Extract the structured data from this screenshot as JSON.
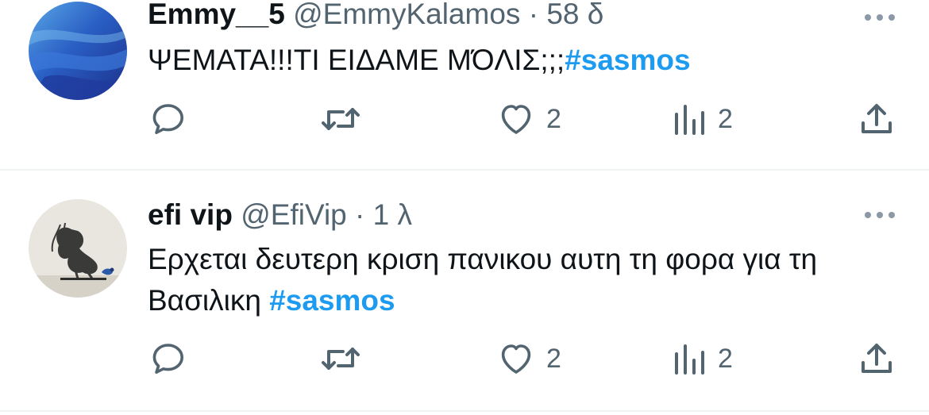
{
  "tweets": [
    {
      "display_name": "Emmy__5",
      "handle": "@EmmyKalamos",
      "separator": "·",
      "time": "58 δ",
      "text": "ΨΕΜΑΤΑ!!!ΤΙ ΕΙΔΑΜΕ ΜΌΛΙΣ;;;",
      "hashtag": "#sasmos",
      "likes": "2",
      "views": "2",
      "avatar": "blue-abstract-avatar"
    },
    {
      "display_name": "efi vip",
      "handle": "@EfiVip",
      "separator": "·",
      "time": "1 λ",
      "text": "Ερχεται δευτερη κριση πανικου αυτη τη φορα για τη Βασιλικη ",
      "hashtag": "#sasmos",
      "likes": "2",
      "views": "2",
      "avatar": "girl-with-bird-avatar"
    }
  ],
  "icons": {
    "reply": "speech-bubble-icon",
    "retweet": "retweet-arrows-icon",
    "like": "heart-icon",
    "views": "bar-chart-icon",
    "share": "upload-arrow-icon",
    "more": "more-dots-icon"
  },
  "colors": {
    "text": "#0f1419",
    "secondary": "#536471",
    "hashtag": "#1d9bf0",
    "divider": "#eff3f4"
  }
}
